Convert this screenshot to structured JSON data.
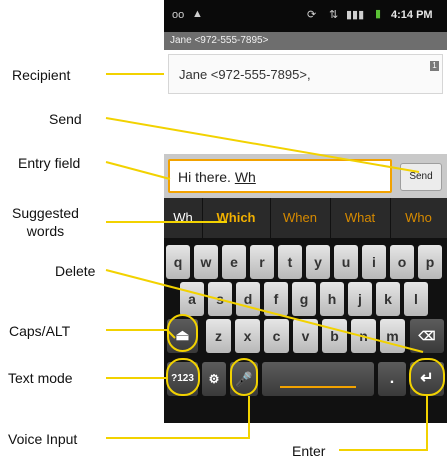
{
  "callouts": {
    "recipient": "Recipient",
    "send": "Send",
    "entry_field": "Entry field",
    "suggested_words_line1": "Suggested",
    "suggested_words_line2": "words",
    "delete": "Delete",
    "caps_alt": "Caps/ALT",
    "text_mode": "Text mode",
    "voice_input": "Voice Input",
    "enter": "Enter"
  },
  "status_bar": {
    "time": "4:14 PM",
    "icons": [
      "voicemail-icon",
      "usb-debug-icon",
      "sync-icon",
      "data-icon",
      "signal-icon",
      "battery-icon"
    ]
  },
  "title_bar": {
    "title": "Jane <972-555-7895>"
  },
  "recipient_field": {
    "value": "Jane <972-555-7895>,",
    "count": "1"
  },
  "compose": {
    "entry_value_prefix": "Hi there. ",
    "entry_value_underlined": "Wh",
    "send_label": "Send"
  },
  "suggestions": [
    "Wh",
    "Which",
    "When",
    "What",
    "Who"
  ],
  "keyboard": {
    "row1": [
      "q",
      "w",
      "e",
      "r",
      "t",
      "y",
      "u",
      "i",
      "o",
      "p"
    ],
    "row2": [
      "a",
      "s",
      "d",
      "f",
      "g",
      "h",
      "j",
      "k",
      "l"
    ],
    "row3": [
      "z",
      "x",
      "c",
      "v",
      "b",
      "n",
      "m"
    ],
    "mode_label": "?123",
    "period": "."
  },
  "colors": {
    "accent": "#f2d200",
    "field_focus": "#f2a200"
  }
}
